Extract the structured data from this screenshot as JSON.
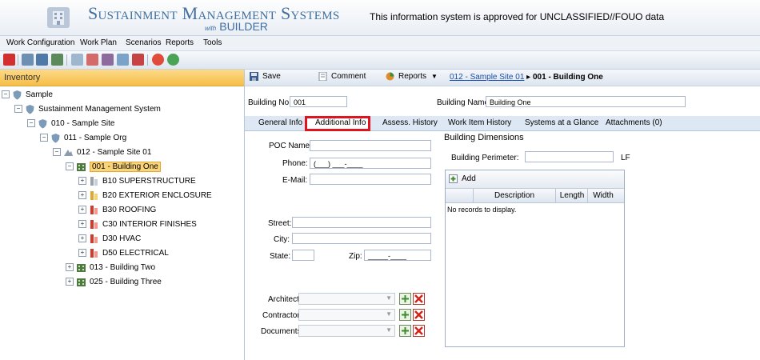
{
  "header": {
    "title": "Sustainment Management Systems",
    "sub_with": "with",
    "sub_builder": "BUILDER",
    "classification": "This information system is approved for UNCLASSIFIED//FOUO data"
  },
  "menu": [
    "Work Configuration",
    "Work Plan",
    "Scenarios",
    "Reports",
    "Tools"
  ],
  "sidebar": {
    "title": "Inventory",
    "tree": [
      {
        "label": "Sample",
        "icon": "shield-icon"
      },
      {
        "label": "Sustainment Management System",
        "icon": "shield-icon"
      },
      {
        "label": "010 - Sample Site",
        "icon": "shield-icon"
      },
      {
        "label": "011 - Sample Org",
        "icon": "shield-icon"
      },
      {
        "label": "012 - Sample Site 01",
        "icon": "site-icon"
      },
      {
        "label": "001 - Building One",
        "icon": "building-icon"
      },
      {
        "label": "B10 SUPERSTRUCTURE",
        "icon": "system-icon"
      },
      {
        "label": "B20 EXTERIOR ENCLOSURE",
        "icon": "system-icon"
      },
      {
        "label": "B30 ROOFING",
        "icon": "system-icon"
      },
      {
        "label": "C30 INTERIOR FINISHES",
        "icon": "system-icon"
      },
      {
        "label": "D30 HVAC",
        "icon": "system-icon"
      },
      {
        "label": "D50 ELECTRICAL",
        "icon": "system-icon"
      },
      {
        "label": "013 - Building Two",
        "icon": "building-icon"
      },
      {
        "label": "025 - Building Three",
        "icon": "building-icon"
      }
    ]
  },
  "content_toolbar": {
    "save": "Save",
    "comment": "Comment",
    "reports": "Reports",
    "breadcrumb_link": "012 - Sample Site 01",
    "breadcrumb_sep": "▸",
    "breadcrumb_current": "001 - Building One"
  },
  "building": {
    "no_label": "Building No:",
    "no_value": "001",
    "name_label": "Building Name:",
    "name_value": "Building One"
  },
  "tabs": [
    "General Info",
    "Additional Info",
    "Assess. History",
    "Work Item History",
    "Systems at a Glance",
    "Attachments (0)"
  ],
  "form": {
    "poc_label": "POC Name:",
    "poc_value": "",
    "phone_label": "Phone:",
    "phone_value": "(___) ___-____",
    "email_label": "E-Mail:",
    "email_value": "",
    "street_label": "Street:",
    "street_value": "",
    "city_label": "City:",
    "city_value": "",
    "state_label": "State:",
    "state_value": "",
    "zip_label": "Zip:",
    "zip_value": "_____-____",
    "architect_label": "Architect:",
    "contractor_label": "Contractor:",
    "documents_label": "Documents:"
  },
  "dimensions": {
    "title": "Building Dimensions",
    "perimeter_label": "Building Perimeter:",
    "perimeter_value": "",
    "unit": "LF",
    "add": "Add",
    "columns": [
      "Description",
      "Length",
      "Width"
    ],
    "empty": "No records to display."
  },
  "colors": {
    "accent": "#3f6fa0",
    "highlight_border": "#e0141e",
    "selected": "#f9d47a"
  }
}
